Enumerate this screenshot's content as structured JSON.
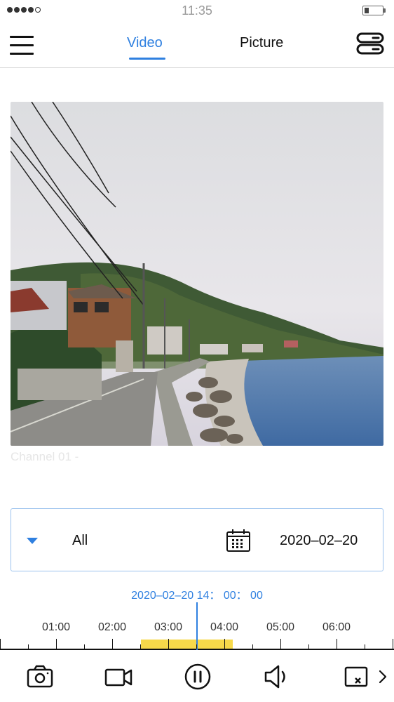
{
  "status_bar": {
    "time": "11:35",
    "signal_icon": "signal-dots-icon",
    "battery_icon": "battery-low-icon"
  },
  "nav": {
    "menu_icon": "hamburger-menu-icon",
    "tabs": [
      {
        "label": "Video",
        "active": true
      },
      {
        "label": "Picture",
        "active": false
      }
    ],
    "device_icon": "device-list-icon",
    "accent_color": "#2f80e0"
  },
  "player": {
    "channel_label": "Channel 01 -"
  },
  "filter": {
    "type_value": "All",
    "date_value": "2020–02–20",
    "dropdown_icon": "caret-down-icon",
    "calendar_icon": "calendar-icon"
  },
  "timeline": {
    "current_time": "2020–02–20 14： 00： 00",
    "labels": [
      "01:00",
      "02:00",
      "03:00",
      "04:00",
      "05:00",
      "06:00"
    ],
    "record_color": "#f7d94a"
  },
  "toolbar": {
    "buttons": [
      "snapshot-camera-icon",
      "record-video-icon",
      "pause-icon",
      "volume-icon",
      "close-window-icon",
      "chevron-right-icon"
    ]
  }
}
